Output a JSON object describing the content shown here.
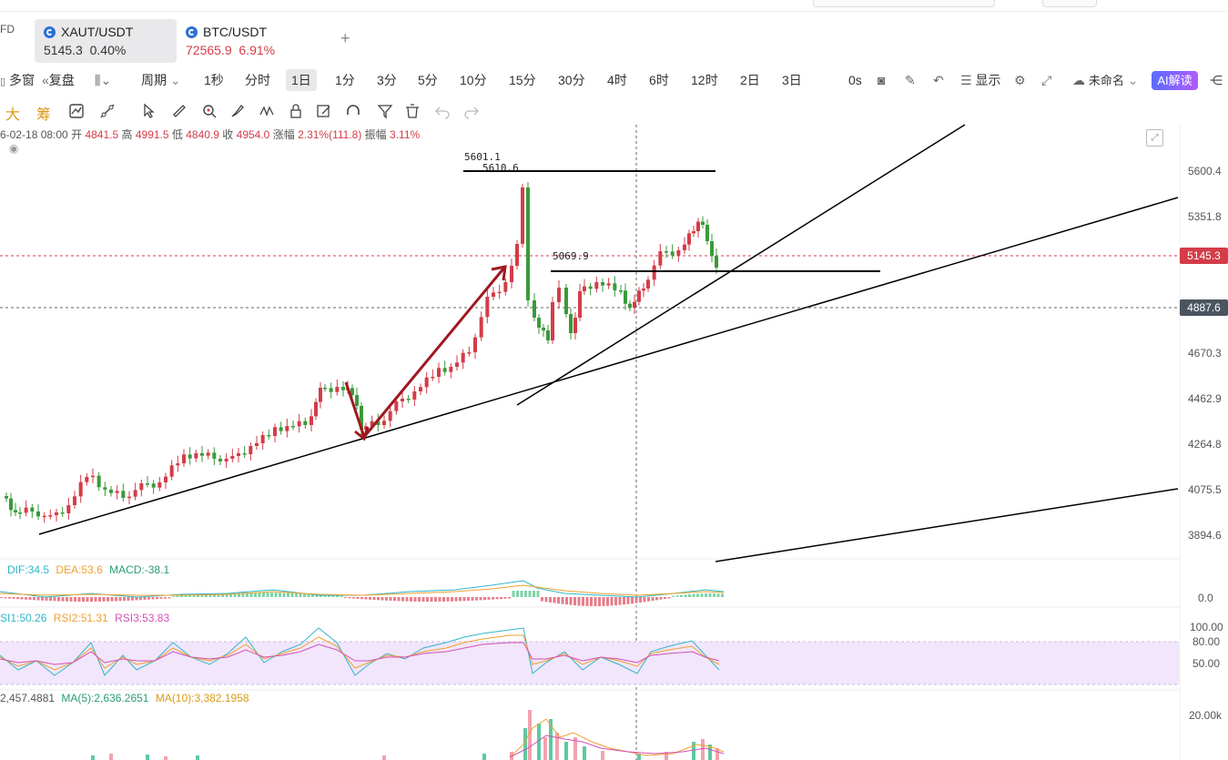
{
  "header": {
    "left_cut_label": "FD",
    "tabs": [
      {
        "symbol": "XAUT/USDT",
        "price": "5145.3",
        "change": "0.40%",
        "active": true
      },
      {
        "symbol": "BTC/USDT",
        "price": "72565.9",
        "change": "6.91%",
        "active": false
      }
    ],
    "add_tab_glyph": "+"
  },
  "toolbar": {
    "multi_window": "多窗",
    "replay": "复盘",
    "period_label": "周期",
    "intervals": [
      "1秒",
      "分时",
      "1日",
      "1分",
      "3分",
      "5分",
      "10分",
      "15分",
      "30分",
      "4时",
      "6时",
      "12时",
      "2日",
      "3日"
    ],
    "selected_interval": "1日",
    "countdown": "0s",
    "display_label": "显示",
    "layout_name": "未命名",
    "ai_button": "AI解读"
  },
  "drawing_tools": {
    "big_label": "大",
    "chip_label": "筹"
  },
  "ohlc": {
    "date": "6-02-18 08:00",
    "open_label": "开",
    "open": "4841.5",
    "high_label": "高",
    "high": "4991.5",
    "low_label": "低",
    "low": "4840.9",
    "close_label": "收",
    "close": "4954.0",
    "change_label": "涨幅",
    "change": "2.31%(111.8)",
    "amp_label": "振幅",
    "amp": "3.11%"
  },
  "chart_labels": {
    "high_mark_1": "5601.1",
    "high_mark_2": "5610.6",
    "support_mark": "5069.9"
  },
  "price_axis": [
    "5600.4",
    "5351.8",
    "4670.3",
    "4462.9",
    "4264.8",
    "4075.5",
    "3894.6"
  ],
  "price_tags": {
    "last": "5145.3",
    "cursor": "4887.6"
  },
  "macd": {
    "dif": "DIF:34.5",
    "dea": "DEA:53.6",
    "macd": "MACD:-38.1",
    "axis": "0.0"
  },
  "rsi": {
    "rsi1": "SI1:50.26",
    "rsi2": "RSI2:51.31",
    "rsi3": "RSI3:53.83",
    "axis": [
      "100.00",
      "80.00",
      "50.00"
    ]
  },
  "volume": {
    "vol": "2,457.4881",
    "ma5": "MA(5):2,636.2651",
    "ma10": "MA(10):3,382.1958",
    "axis": "20.00k"
  },
  "colors": {
    "up": "#d43c48",
    "down": "#3a9a3a",
    "accent": "#5b6cff",
    "cursor_tag": "#4a5560",
    "arrow": "#a01820"
  }
}
